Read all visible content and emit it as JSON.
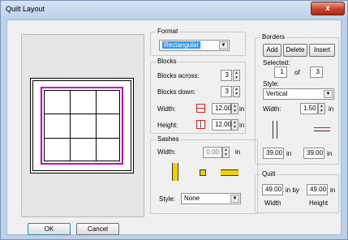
{
  "window": {
    "title": "Quilt Layout",
    "close_glyph": "x"
  },
  "format": {
    "legend": "Format",
    "selected": "Rectangular"
  },
  "blocks": {
    "legend": "Blocks",
    "across_label": "Blocks across:",
    "across_value": "3",
    "down_label": "Blocks down:",
    "down_value": "3",
    "width_label": "Width:",
    "width_value": "12.00",
    "width_unit": "in",
    "height_label": "Height:",
    "height_value": "12.00",
    "height_unit": "in"
  },
  "sashes": {
    "legend": "Sashes",
    "width_label": "Width:",
    "width_value": "0.00",
    "width_unit": "in",
    "style_label": "Style:",
    "style_value": "None"
  },
  "borders": {
    "legend": "Borders",
    "add_label": "Add",
    "delete_label": "Delete",
    "insert_label": "Insert",
    "selected_label": "Selected:",
    "selected_value": "1",
    "of_label": "of",
    "total_value": "3",
    "style_label": "Style:",
    "style_value": "Vertical",
    "width_label": "Width:",
    "width_value": "1.50",
    "width_unit": "in",
    "left_value": "39.00",
    "left_unit": "in",
    "right_value": "39.00",
    "right_unit": "in"
  },
  "quilt": {
    "legend": "Quilt",
    "width_value": "49.00",
    "width_unit": "in by",
    "height_value": "49.00",
    "height_unit": "in",
    "width_caption": "Width",
    "height_caption": "Height"
  },
  "footer": {
    "ok_label": "OK",
    "cancel_label": "Cancel"
  },
  "colors": {
    "accent": "#cc00cc",
    "highlight": "#3399ff",
    "swatch_red": "#cc2222",
    "swatch_yellow": "#f2d000"
  }
}
